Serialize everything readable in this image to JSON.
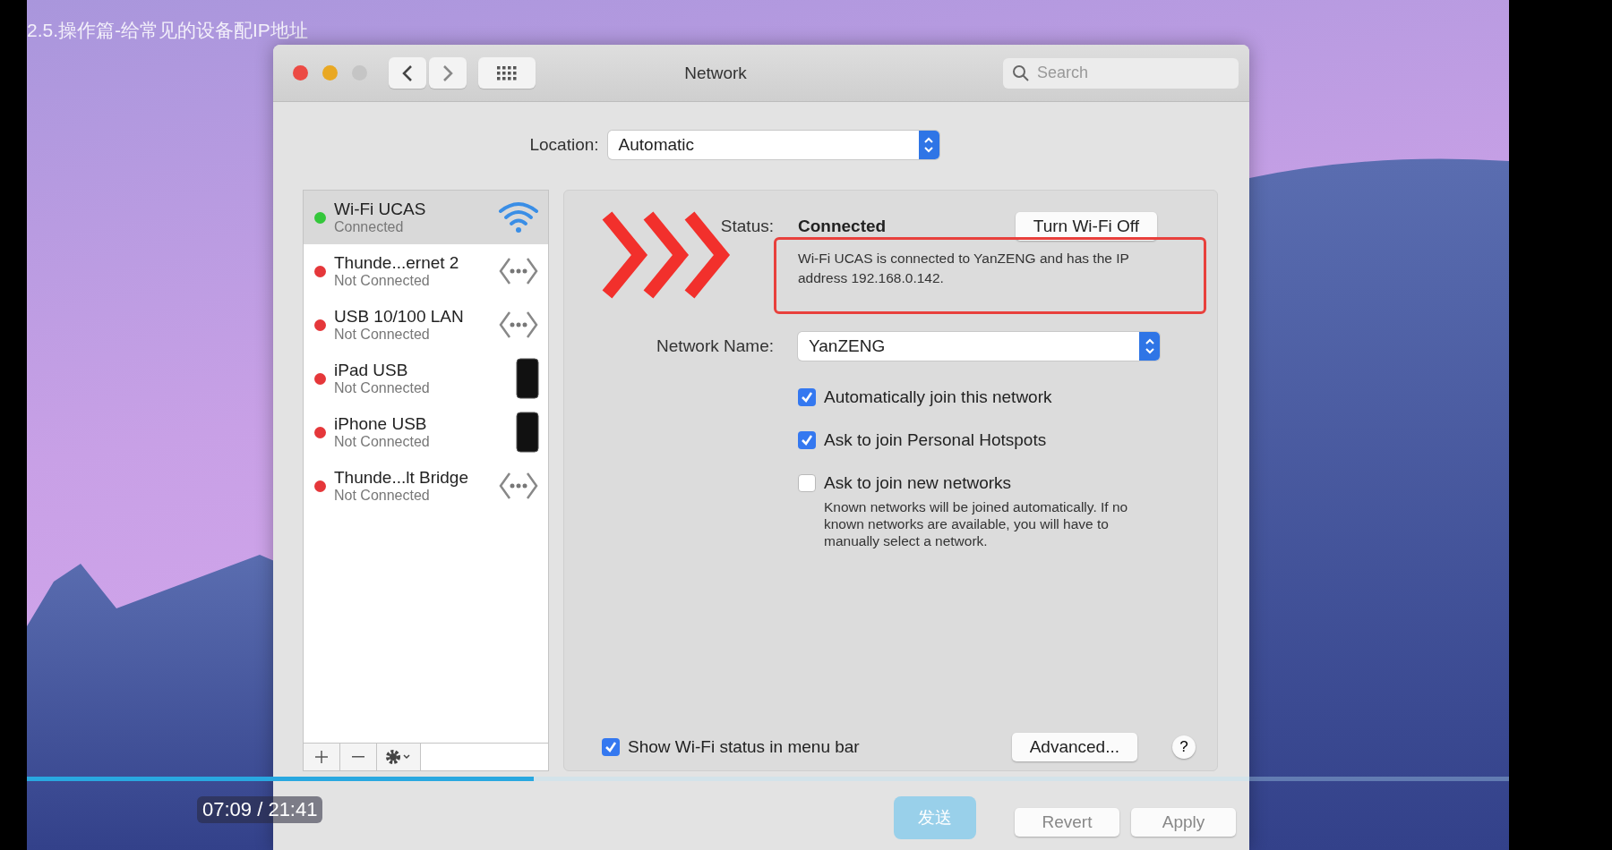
{
  "video_title": "2.5.操作篇-给常见的设备配IP地址",
  "window": {
    "title": "Network",
    "search": {
      "placeholder": "Search"
    }
  },
  "location": {
    "label": "Location:",
    "value": "Automatic"
  },
  "services": [
    {
      "name": "Wi-Fi UCAS",
      "status": "Connected",
      "color": "#34c73b",
      "kind": "wifi",
      "selected": true
    },
    {
      "name": "Thunde...ernet 2",
      "status": "Not Connected",
      "color": "#e5373a",
      "kind": "ethernet",
      "selected": false
    },
    {
      "name": "USB 10/100 LAN",
      "status": "Not Connected",
      "color": "#e5373a",
      "kind": "ethernet",
      "selected": false
    },
    {
      "name": "iPad USB",
      "status": "Not Connected",
      "color": "#e5373a",
      "kind": "device",
      "selected": false
    },
    {
      "name": "iPhone USB",
      "status": "Not Connected",
      "color": "#e5373a",
      "kind": "device",
      "selected": false
    },
    {
      "name": "Thunde...lt Bridge",
      "status": "Not Connected",
      "color": "#e5373a",
      "kind": "ethernet",
      "selected": false
    }
  ],
  "status": {
    "label": "Status:",
    "value": "Connected",
    "button": "Turn Wi-Fi Off",
    "description": "Wi-Fi UCAS is connected to YanZENG and has the IP address 192.168.0.142."
  },
  "network_name": {
    "label": "Network Name:",
    "value": "YanZENG"
  },
  "options": [
    {
      "label": "Automatically join this network",
      "checked": true
    },
    {
      "label": "Ask to join Personal Hotspots",
      "checked": true
    },
    {
      "label": "Ask to join new networks",
      "checked": false
    }
  ],
  "note": "Known networks will be joined automatically. If no known networks are available, you will have to manually select a network.",
  "show_status": {
    "label": "Show Wi-Fi status in menu bar",
    "checked": true
  },
  "buttons": {
    "advanced": "Advanced...",
    "help": "?",
    "revert": "Revert",
    "apply": "Apply"
  },
  "player": {
    "time": "07:09 / 21:41",
    "send": "发送",
    "progress": {
      "level": 0.33
    }
  }
}
